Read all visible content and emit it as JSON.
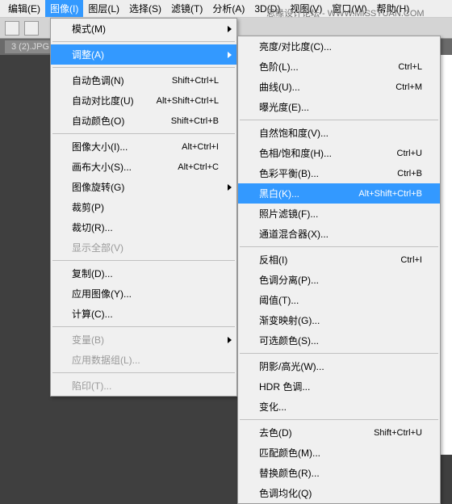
{
  "menubar": {
    "items": [
      "编辑(E)",
      "图像(I)",
      "图层(L)",
      "选择(S)",
      "滤镜(T)",
      "分析(A)",
      "3D(D)",
      "视图(V)",
      "窗口(W)",
      "帮助(H)"
    ],
    "activeIndex": 1
  },
  "watermark": "思缘设计论坛 - WWW.MISSYUAN.COM",
  "tab": {
    "label": "3 (2).JPG"
  },
  "menu1": {
    "sections": [
      [
        {
          "label": "模式(M)",
          "sub": true
        }
      ],
      [
        {
          "label": "调整(A)",
          "sub": true,
          "hl": true
        }
      ],
      [
        {
          "label": "自动色调(N)",
          "sc": "Shift+Ctrl+L"
        },
        {
          "label": "自动对比度(U)",
          "sc": "Alt+Shift+Ctrl+L"
        },
        {
          "label": "自动颜色(O)",
          "sc": "Shift+Ctrl+B"
        }
      ],
      [
        {
          "label": "图像大小(I)...",
          "sc": "Alt+Ctrl+I"
        },
        {
          "label": "画布大小(S)...",
          "sc": "Alt+Ctrl+C"
        },
        {
          "label": "图像旋转(G)",
          "sub": true
        },
        {
          "label": "裁剪(P)"
        },
        {
          "label": "裁切(R)..."
        },
        {
          "label": "显示全部(V)",
          "disabled": true
        }
      ],
      [
        {
          "label": "复制(D)..."
        },
        {
          "label": "应用图像(Y)..."
        },
        {
          "label": "计算(C)..."
        }
      ],
      [
        {
          "label": "变量(B)",
          "sub": true,
          "disabled": true
        },
        {
          "label": "应用数据组(L)...",
          "disabled": true
        }
      ],
      [
        {
          "label": "陷印(T)...",
          "disabled": true
        }
      ]
    ]
  },
  "menu2": {
    "sections": [
      [
        {
          "label": "亮度/对比度(C)..."
        },
        {
          "label": "色阶(L)...",
          "sc": "Ctrl+L"
        },
        {
          "label": "曲线(U)...",
          "sc": "Ctrl+M"
        },
        {
          "label": "曝光度(E)..."
        }
      ],
      [
        {
          "label": "自然饱和度(V)..."
        },
        {
          "label": "色相/饱和度(H)...",
          "sc": "Ctrl+U"
        },
        {
          "label": "色彩平衡(B)...",
          "sc": "Ctrl+B"
        },
        {
          "label": "黑白(K)...",
          "sc": "Alt+Shift+Ctrl+B",
          "hl": true
        },
        {
          "label": "照片滤镜(F)..."
        },
        {
          "label": "通道混合器(X)..."
        }
      ],
      [
        {
          "label": "反相(I)",
          "sc": "Ctrl+I"
        },
        {
          "label": "色调分离(P)..."
        },
        {
          "label": "阈值(T)..."
        },
        {
          "label": "渐变映射(G)..."
        },
        {
          "label": "可选颜色(S)..."
        }
      ],
      [
        {
          "label": "阴影/高光(W)..."
        },
        {
          "label": "HDR 色调..."
        },
        {
          "label": "变化..."
        }
      ],
      [
        {
          "label": "去色(D)",
          "sc": "Shift+Ctrl+U"
        },
        {
          "label": "匹配颜色(M)..."
        },
        {
          "label": "替换颜色(R)..."
        },
        {
          "label": "色调均化(Q)"
        }
      ]
    ]
  }
}
